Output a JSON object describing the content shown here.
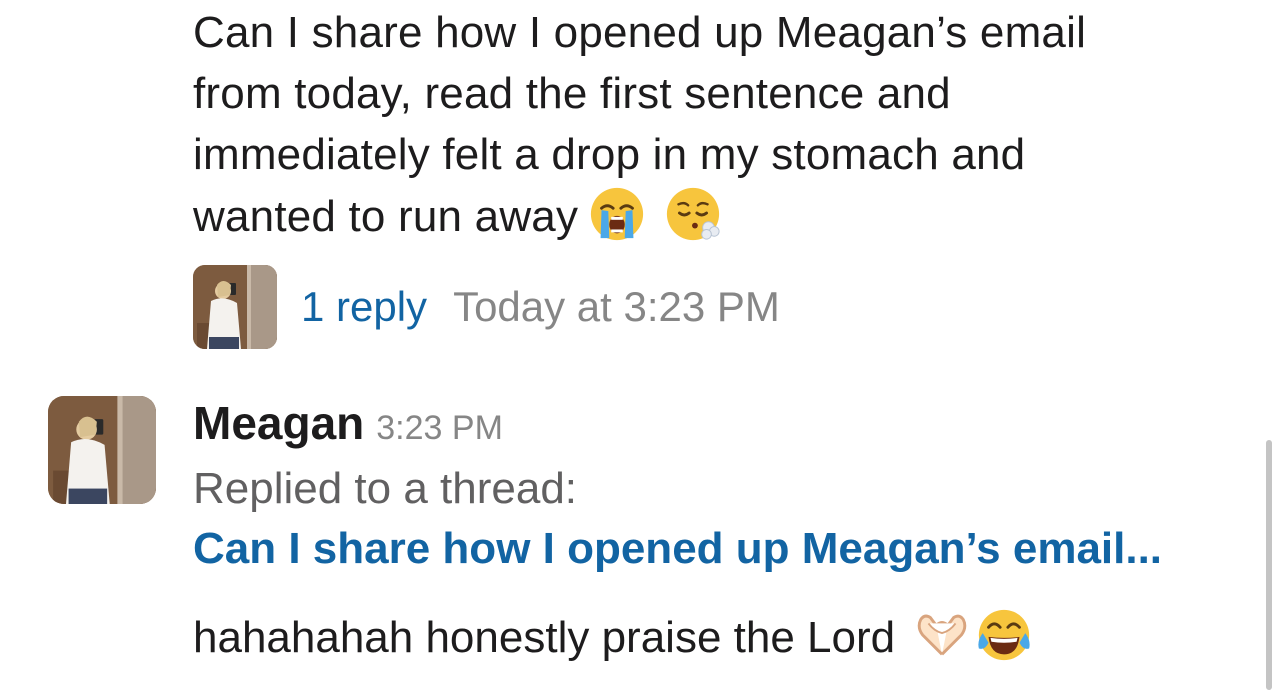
{
  "message": {
    "lines": [
      "Can I share how I opened up Meagan’s email",
      "from today, read the first sentence and",
      "immediately felt a drop in my stomach and",
      "wanted to run away"
    ],
    "emojis": [
      "loudly-crying-face",
      "face-exhaling"
    ]
  },
  "thread": {
    "reply_count": "1 reply",
    "last_reply": "Today at 3:23 PM"
  },
  "reply_message": {
    "author": "Meagan",
    "time": "3:23 PM",
    "context_label": "Replied to a thread:",
    "thread_preview": "Can I share how I opened up Meagan’s email...",
    "text": "hahahahah honestly praise the Lord",
    "emojis": [
      "heart-hands",
      "face-with-tears-of-joy"
    ]
  },
  "colors": {
    "link": "#1264a3",
    "text": "#1d1c1d",
    "muted": "#868686"
  }
}
